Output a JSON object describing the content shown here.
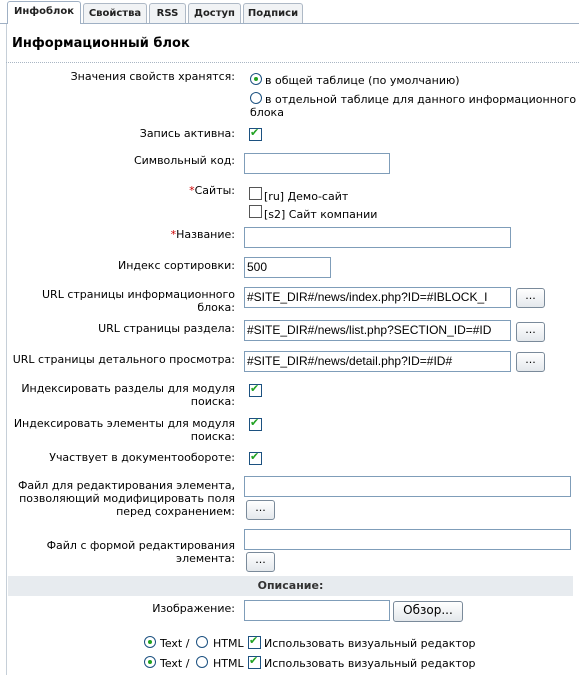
{
  "tabs": [
    "Инфоблок",
    "Свойства",
    "RSS",
    "Доступ",
    "Подписи"
  ],
  "title": "Информационный блок",
  "storage": {
    "label": "Значения свойств хранятся:",
    "option1": "в общей таблице (по умолчанию)",
    "option2_line1": "в отдельной таблице для данного информационного",
    "option2_line2": "блока"
  },
  "active": {
    "label": "Запись активна:"
  },
  "code": {
    "label": "Символьный код:",
    "value": ""
  },
  "sites": {
    "label": "Сайты:",
    "required_mark": "*",
    "items": [
      "[ru] Демо-сайт",
      "[s2] Сайт компании"
    ]
  },
  "name": {
    "label": "Название:",
    "required_mark": "*",
    "value": ""
  },
  "sort": {
    "label": "Индекс сортировки:",
    "value": "500"
  },
  "url_list": {
    "label_line1": "URL страницы информационного",
    "label_line2": "блока:",
    "value": "#SITE_DIR#/news/index.php?ID=#IBLOCK_I"
  },
  "url_section": {
    "label": "URL страницы раздела:",
    "value": "#SITE_DIR#/news/list.php?SECTION_ID=#ID"
  },
  "url_detail": {
    "label": "URL страницы детального просмотра:",
    "value": "#SITE_DIR#/news/detail.php?ID=#ID#"
  },
  "browse_button": "...",
  "index_sections": {
    "label_line1": "Индексировать разделы для модуля",
    "label_line2": "поиска:"
  },
  "index_elements": {
    "label_line1": "Индексировать элементы для модуля",
    "label_line2": "поиска:"
  },
  "workflow": {
    "label": "Участвует в документообороте:"
  },
  "edit_file": {
    "label_line1": "Файл для редактирования элемента,",
    "label_line2": "позволяющий модифицировать поля",
    "label_line3": "перед сохранением:",
    "value": ""
  },
  "form_file": {
    "label_line1": "Файл с формой редактирования",
    "label_line2": "элемента:",
    "value": ""
  },
  "description_section": "Описание:",
  "image": {
    "label": "Изображение:",
    "button": "Обзор...",
    "value": ""
  },
  "editor_row": {
    "text": "Text /",
    "html": "HTML",
    "visual": "Использовать визуальный редактор"
  }
}
